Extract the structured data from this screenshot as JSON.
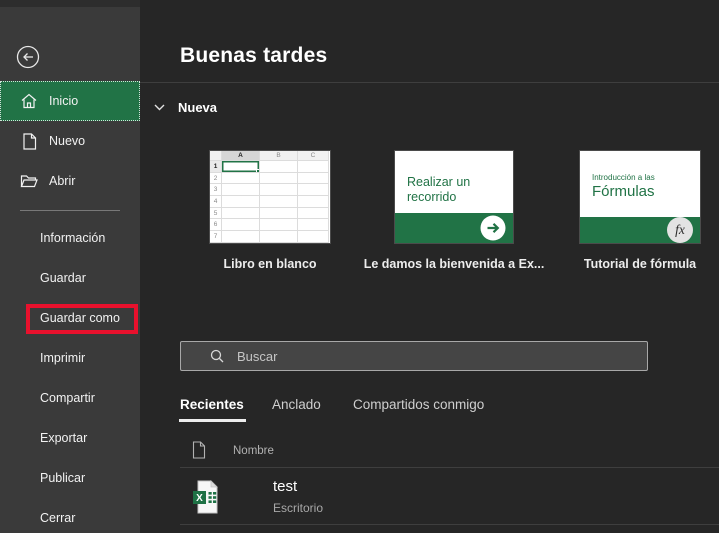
{
  "colors": {
    "accent_green": "#217346",
    "annotation_red": "#e8112d",
    "sidebar_bg": "#3a3a3a",
    "main_bg": "#262626"
  },
  "sidebar": {
    "items_top": [
      {
        "label": "Inicio",
        "active": true
      },
      {
        "label": "Nuevo",
        "active": false
      },
      {
        "label": "Abrir",
        "active": false
      }
    ],
    "items_bottom": [
      {
        "label": "Información"
      },
      {
        "label": "Guardar"
      },
      {
        "label": "Guardar como",
        "annotated": true
      },
      {
        "label": "Imprimir"
      },
      {
        "label": "Compartir"
      },
      {
        "label": "Exportar"
      },
      {
        "label": "Publicar"
      },
      {
        "label": "Cerrar"
      }
    ]
  },
  "main": {
    "greeting": "Buenas tardes",
    "new_section_label": "Nueva",
    "templates": [
      {
        "label": "Libro en blanco"
      },
      {
        "label": "Le damos la bienvenida a Ex...",
        "preview_text": "Realizar un recorrido"
      },
      {
        "label": "Tutorial de fórmula",
        "preview_small": "Introducción a las",
        "preview_title": "Fórmulas",
        "badge": "fx"
      }
    ],
    "search_placeholder": "Buscar",
    "tabs": [
      {
        "label": "Recientes",
        "active": true
      },
      {
        "label": "Anclado",
        "active": false
      },
      {
        "label": "Compartidos conmigo",
        "active": false
      }
    ],
    "list": {
      "name_header": "Nombre",
      "rows": [
        {
          "name": "test",
          "location": "Escritorio"
        }
      ]
    }
  },
  "preview_grid": {
    "columns": [
      "A",
      "B",
      "C"
    ],
    "rows": [
      "1",
      "2",
      "3",
      "4",
      "5",
      "6",
      "7"
    ]
  }
}
